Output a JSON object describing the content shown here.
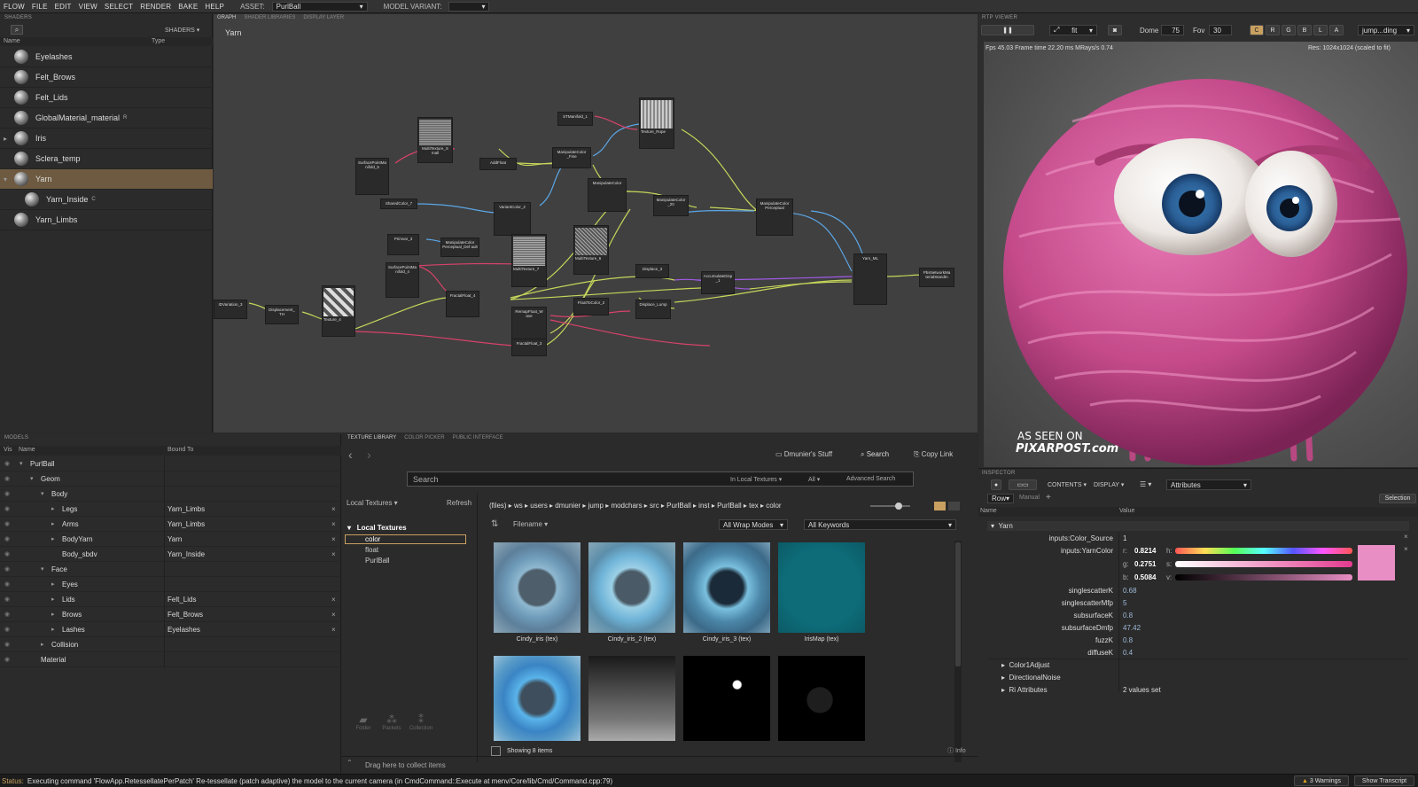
{
  "menu": {
    "items": [
      "FLOW",
      "FILE",
      "EDIT",
      "VIEW",
      "SELECT",
      "RENDER",
      "BAKE",
      "HELP"
    ],
    "asset_label": "ASSET:",
    "asset_value": "PurlBall",
    "variant_label": "MODEL VARIANT:",
    "variant_value": ""
  },
  "shaders": {
    "title": "SHADERS",
    "dropdown": "SHADERS",
    "col_name": "Name",
    "col_type": "Type",
    "items": [
      {
        "label": "Eyelashes",
        "badge": ""
      },
      {
        "label": "Felt_Brows",
        "badge": ""
      },
      {
        "label": "Felt_Lids",
        "badge": ""
      },
      {
        "label": "GlobalMaterial_material",
        "badge": "R"
      },
      {
        "label": "Iris",
        "badge": ""
      },
      {
        "label": "Sclera_temp",
        "badge": ""
      },
      {
        "label": "Yarn",
        "badge": ""
      },
      {
        "label": "Yarn_Inside",
        "badge": "C"
      },
      {
        "label": "Yarn_Limbs",
        "badge": ""
      }
    ]
  },
  "graph": {
    "tabs": [
      "GRAPH",
      "SHADER LIBRARIES",
      "DISPLAY LAYER"
    ],
    "title": "Yarn",
    "nodes": [
      "SurfacePointMa nifold_5",
      "MultiTexture_S mall",
      "AddFloat",
      "STManifold_1",
      "Texture_Rope",
      "ManipulateColor _Fine",
      "ManipulateColor",
      "SharedColor_7",
      "VariantColor_2",
      "ManipulateColor _20",
      "ManipulateColor Perceptual",
      "Primvar_3",
      "ManipulateColor Perceptual_Def ault",
      "MultiTexture_7",
      "MultiTexture_6",
      "SurfacePointMa nifold_4",
      "FractalFloat_4",
      "Displace_3",
      "AccumulateDisp _1",
      "Yarn_ML",
      "PbsNetworkMa terialStandIn",
      "IDVariation_3",
      "Displacement_ TH",
      "Texture_4",
      "RemapFloat_W ave",
      "FloatToColor_2",
      "Displace_Lump",
      "FractalFloat_3"
    ]
  },
  "rtp": {
    "title": "RTP VIEWER",
    "fit": "fit",
    "dome_label": "Dome",
    "dome_value": "75",
    "fov_label": "Fov",
    "fov_value": "30",
    "channels": [
      "C",
      "R",
      "G",
      "B",
      "L",
      "A"
    ],
    "cam": "jump...ding",
    "stats": "Fps 45.03   Frame time 22.20 ms   MRays/s 0.74",
    "res": "Res: 1024x1024 (scaled to fit)",
    "wm1": "AS SEEN ON",
    "wm2": "PIXARPOST.com"
  },
  "models": {
    "title": "MODELS",
    "col_vis": "Vis",
    "col_name": "Name",
    "col_bound": "Bound To",
    "rows": [
      {
        "name": "PurlBall",
        "bound": "",
        "x": false
      },
      {
        "name": "Geom",
        "bound": "",
        "x": false
      },
      {
        "name": "Body",
        "bound": "",
        "x": false
      },
      {
        "name": "Legs",
        "bound": "Yarn_Limbs",
        "x": true
      },
      {
        "name": "Arms",
        "bound": "Yarn_Limbs",
        "x": true
      },
      {
        "name": "BodyYarn",
        "bound": "Yarn",
        "x": true
      },
      {
        "name": "Body_sbdv",
        "bound": "Yarn_Inside",
        "x": true
      },
      {
        "name": "Face",
        "bound": "",
        "x": false
      },
      {
        "name": "Eyes",
        "bound": "",
        "x": false
      },
      {
        "name": "Lids",
        "bound": "Felt_Lids",
        "x": true
      },
      {
        "name": "Brows",
        "bound": "Felt_Brows",
        "x": true
      },
      {
        "name": "Lashes",
        "bound": "Eyelashes",
        "x": true
      },
      {
        "name": "Collision",
        "bound": "",
        "x": false
      },
      {
        "name": "Material",
        "bound": "",
        "x": false
      }
    ]
  },
  "texlib": {
    "tabs": [
      "TEXTURE LIBRARY",
      "COLOR PICKER",
      "PUBLIC INTERFACE"
    ],
    "stuff": "Dmunier's Stuff",
    "search_btn": "Search",
    "copy_link": "Copy Link",
    "search_placeholder": "Search",
    "in_local": "In Local Textures",
    "all": "All",
    "advanced": "Advanced Search",
    "local_dd": "Local Textures",
    "refresh": "Refresh",
    "path": "(files)  ▸  ws  ▸  users  ▸  dmunier  ▸  jump  ▸  modchars  ▸  src  ▸  PurlBall  ▸  inst  ▸  PurlBall  ▸  tex  ▸  color",
    "filename": "Filename",
    "wrap": "All Wrap Modes",
    "keywords": "All Keywords",
    "tree": {
      "root": "Local Textures",
      "items": [
        "color",
        "float",
        "PurlBall"
      ]
    },
    "thumbs": [
      "Cindy_iris (tex)",
      "Cindy_iris_2 (tex)",
      "Cindy_iris_3 (tex)",
      "IrisMap (tex)"
    ],
    "showing": "Showing 8 items",
    "info": "Info",
    "drag": "Drag here to collect items",
    "bottom_btns": [
      "Folder",
      "Packets",
      "Collection"
    ]
  },
  "inspector": {
    "title": "INSPECTOR",
    "contents": "CONTENTS",
    "display": "DISPLAY",
    "attributes": "Attributes",
    "row": "Row",
    "manual": "Manual",
    "selection": "Selection",
    "col_name": "Name",
    "col_value": "Value",
    "group": "Yarn",
    "attrs": [
      {
        "k": "inputs:Color_Source",
        "v": "1"
      },
      {
        "k": "singlescatterK",
        "v": "0.68"
      },
      {
        "k": "singlescatterMfp",
        "v": "5"
      },
      {
        "k": "subsurfaceK",
        "v": "0.8"
      },
      {
        "k": "subsurfaceDmfp",
        "v": "47.42"
      },
      {
        "k": "fuzzK",
        "v": "0.8"
      },
      {
        "k": "diffuseK",
        "v": "0.4"
      }
    ],
    "yarncolor_label": "inputs:YarnColor",
    "r": "0.8214",
    "g": "0.2751",
    "b": "0.5084",
    "swatch": "#e88ec4",
    "subgroups": [
      "Color1Adjust",
      "DirectionalNoise",
      "Ri Attributes"
    ],
    "ri_value": "2 values set"
  },
  "status": {
    "label": "Status:",
    "text": "Executing command 'FlowApp.RetessellatePerPatch' Re-tessellate (patch adaptive) the model to the current camera (in CmdCommand::Execute at menv/Core/lib/Cmd/Command.cpp:79)",
    "warnings": "3 Warnings",
    "transcript": "Show Transcript"
  }
}
